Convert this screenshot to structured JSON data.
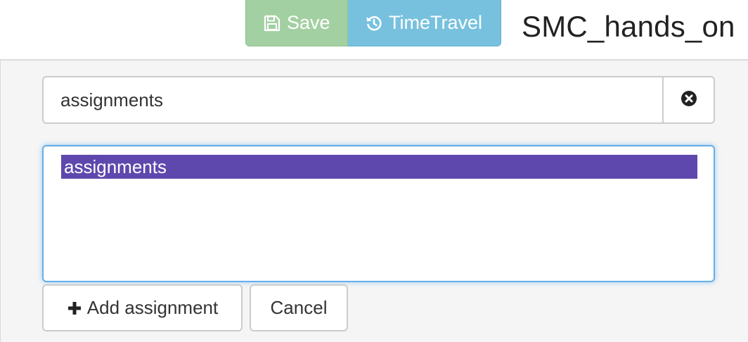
{
  "toolbar": {
    "save_label": "Save",
    "save_icon": "floppy-disk-icon",
    "timetravel_label": "TimeTravel",
    "timetravel_icon": "history-icon",
    "save_color": "#a3d0a2",
    "timetravel_color": "#78c1de"
  },
  "project": {
    "title": "SMC_hands_on"
  },
  "search": {
    "value": "assignments",
    "clear_icon": "times-circle-icon"
  },
  "list": {
    "items": [
      {
        "label": "assignments",
        "selected": true
      }
    ],
    "selected_color": "#5e48ad"
  },
  "actions": {
    "add_label": "Add assignment",
    "add_icon": "plus-icon",
    "cancel_label": "Cancel"
  }
}
